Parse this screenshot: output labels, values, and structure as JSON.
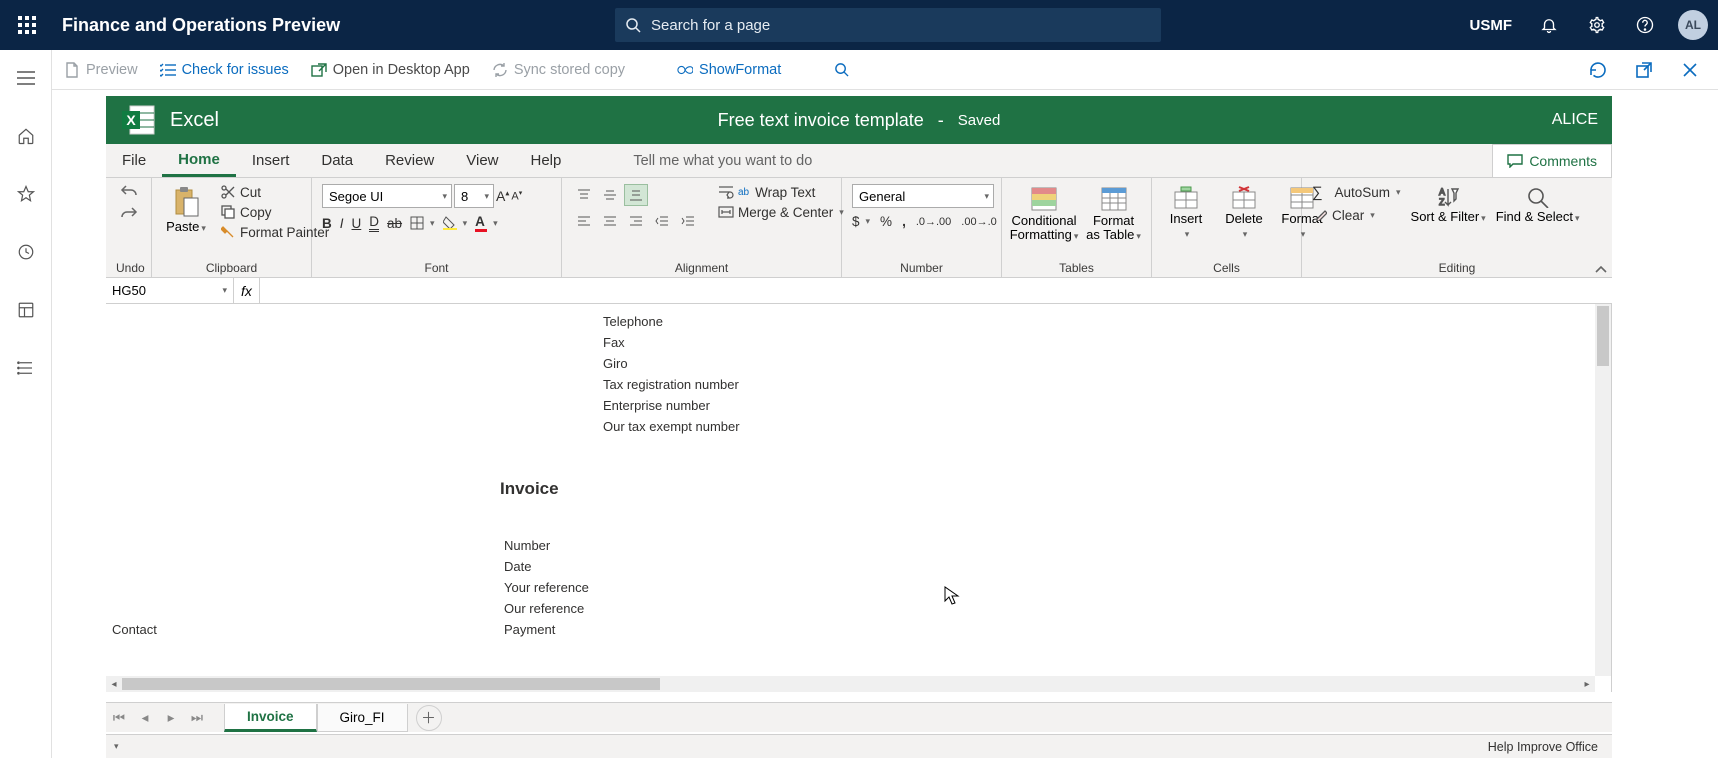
{
  "topbar": {
    "title": "Finance and Operations Preview",
    "search_placeholder": "Search for a page",
    "company": "USMF",
    "avatar": "AL"
  },
  "subheader": {
    "preview": "Preview",
    "check": "Check for issues",
    "open_desktop": "Open in Desktop App",
    "sync": "Sync stored copy",
    "showformat": "ShowFormat"
  },
  "excel": {
    "app": "Excel",
    "doc": "Free text invoice template",
    "sep": "-",
    "saved": "Saved",
    "user": "ALICE"
  },
  "tabs": {
    "file": "File",
    "home": "Home",
    "insert": "Insert",
    "data": "Data",
    "review": "Review",
    "view": "View",
    "help": "Help",
    "tellme": "Tell me what you want to do",
    "comments": "Comments"
  },
  "ribbon": {
    "undo": "Undo",
    "paste": "Paste",
    "cut": "Cut",
    "copy": "Copy",
    "formatpainter": "Format Painter",
    "clipboard": "Clipboard",
    "font_name": "Segoe UI",
    "font_size": "8",
    "font": "Font",
    "wrap": "Wrap Text",
    "merge": "Merge & Center",
    "alignment": "Alignment",
    "numfmt": "General",
    "number": "Number",
    "condfmt": "Conditional Formatting",
    "fmt_table": "Format as Table",
    "tables": "Tables",
    "ins": "Insert",
    "del": "Delete",
    "fmt": "Format",
    "cells": "Cells",
    "autosum": "AutoSum",
    "clear": "Clear",
    "sortfilter": "Sort & Filter",
    "findselect": "Find & Select",
    "editing": "Editing"
  },
  "formula": {
    "namebox": "HG50"
  },
  "sheet": {
    "telephone": "Telephone",
    "fax": "Fax",
    "giro": "Giro",
    "taxreg": "Tax registration number",
    "enterprise": "Enterprise number",
    "taxexempt": "Our tax exempt number",
    "invoice": "Invoice",
    "number": "Number",
    "date": "Date",
    "yourref": "Your reference",
    "ourref": "Our reference",
    "contact": "Contact",
    "payment": "Payment"
  },
  "worksheets": {
    "invoice": "Invoice",
    "giro": "Giro_FI"
  },
  "status": {
    "help": "Help Improve Office"
  }
}
